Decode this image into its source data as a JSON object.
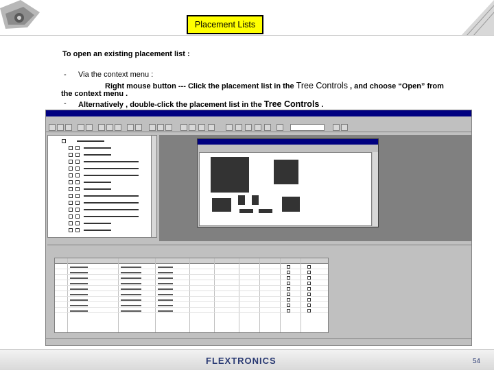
{
  "slide": {
    "title": "Placement Lists",
    "intro": "To open an existing placement list :",
    "bullet1_marker": "-",
    "bullet1_text": "Via the context menu :",
    "bullet1_detail_a": "Right mouse button --- Click the placement list in the ",
    "tree_controls_1": "Tree Controls",
    "bullet1_detail_b": " , and choose “Open” from",
    "bullet1_detail_c": "the context menu .",
    "bullet2_marker": "-",
    "bullet2_text_a": "Alternatively , double-click the placement list in the ",
    "tree_controls_2": "Tree Controls",
    "bullet2_text_b": " ."
  },
  "footer": {
    "brand": "FLEXTRONICS",
    "page_number": "54"
  },
  "colors": {
    "title_bg": "#ffff00",
    "window_title": "#000080",
    "brand": "#2a3a73"
  }
}
